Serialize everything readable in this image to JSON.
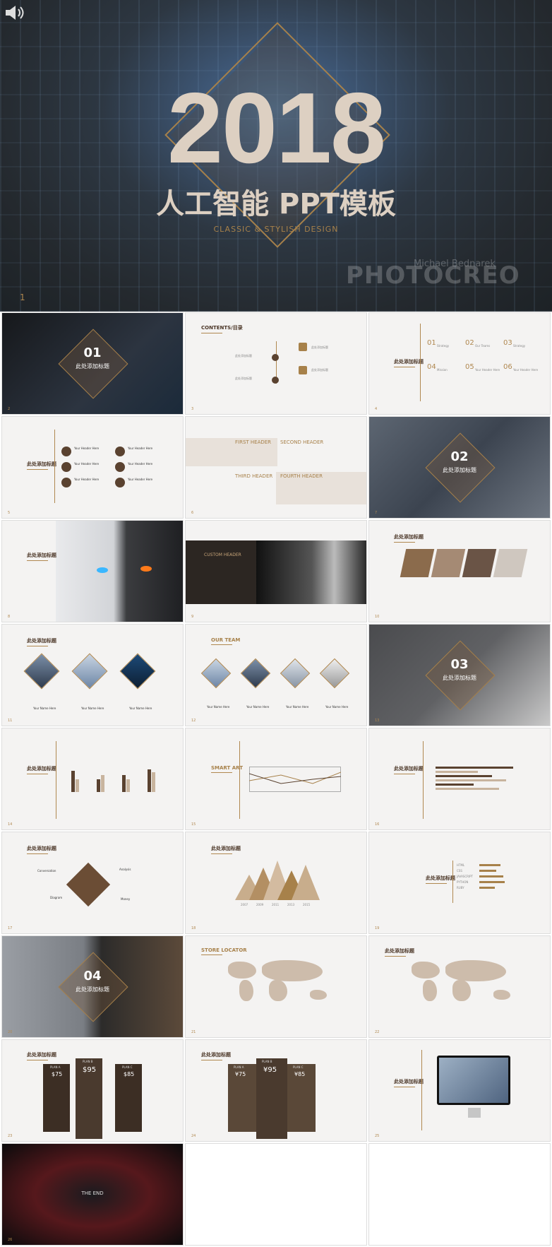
{
  "hero": {
    "year": "2018",
    "title": "人工智能 PPT模板",
    "tagline": "CLASSIC & STYLISH DESIGN",
    "slide_number": "1",
    "watermark": "PHOTOCREO",
    "watermark_small": "Michael Bednarek",
    "speaker_icon": "speaker-icon"
  },
  "slides": [
    {
      "num": "2",
      "section": "01",
      "title": "此处添加标题"
    },
    {
      "num": "3",
      "heading": "CONTENTS/目录",
      "items": [
        "此处添加标题",
        "此处添加标题",
        "此处添加标题",
        "此处添加标题"
      ]
    },
    {
      "num": "4",
      "title": "此处添加标题",
      "points": [
        "01",
        "02",
        "03",
        "04",
        "05",
        "06"
      ],
      "labels": [
        "Strategy",
        "Our Teams",
        "Strategy",
        "Mission",
        "Your Header Here",
        "Your Header Here"
      ]
    },
    {
      "num": "5",
      "title": "此处添加标题",
      "items": [
        "Your Header Here",
        "Your Header Here",
        "Your Header Here",
        "Your Header Here",
        "Your Header Here",
        "Your Header Here"
      ]
    },
    {
      "num": "6",
      "headers": [
        "FIRST HEADER",
        "SECOND HEADER",
        "THIRD HEADER",
        "FOURTH HEADER"
      ]
    },
    {
      "num": "7",
      "section": "02",
      "title": "此处添加标题"
    },
    {
      "num": "8",
      "title": "此处添加标题"
    },
    {
      "num": "9",
      "heading": "CUSTOM HEADER"
    },
    {
      "num": "10",
      "title": "此处添加标题"
    },
    {
      "num": "11",
      "title": "此处添加标题",
      "names": [
        "Your Name Here",
        "Your Name Here",
        "Your Name Here"
      ]
    },
    {
      "num": "12",
      "heading": "OUR TEAM",
      "names": [
        "Your Name Here",
        "Your Name Here",
        "Your Name Here",
        "Your Name Here"
      ]
    },
    {
      "num": "13",
      "section": "03",
      "title": "此处添加标题"
    },
    {
      "num": "14",
      "title": "此处添加标题"
    },
    {
      "num": "15",
      "heading": "SMART ART"
    },
    {
      "num": "16",
      "title": "此处添加标题"
    },
    {
      "num": "17",
      "title": "此处添加标题",
      "labels": [
        "Conversation",
        "Analysis",
        "Diagram",
        "Money"
      ]
    },
    {
      "num": "18",
      "title": "此处添加标题",
      "years": [
        "2007",
        "2009",
        "2011",
        "2013",
        "2015"
      ]
    },
    {
      "num": "19",
      "title": "此处添加标题",
      "skills": [
        "HTML",
        "CSS",
        "JAVASCRIPT",
        "PYTHON",
        "RUBY"
      ]
    },
    {
      "num": "20",
      "section": "04",
      "title": "此处添加标题"
    },
    {
      "num": "21",
      "heading": "STORE LOCATOR"
    },
    {
      "num": "22",
      "title": "此处添加标题"
    },
    {
      "num": "23",
      "title": "此处添加标题",
      "plans": [
        "PLAN A",
        "PLAN B",
        "PLAN C"
      ],
      "prices": [
        "$75",
        "$95",
        "$85"
      ]
    },
    {
      "num": "24",
      "title": "此处添加标题",
      "plans": [
        "PLAN A",
        "PLAN B",
        "PLAN C"
      ],
      "prices": [
        "¥75",
        "¥95",
        "¥85"
      ]
    },
    {
      "num": "25",
      "title": "此处添加标题"
    },
    {
      "num": "26",
      "title": "THE END"
    }
  ]
}
